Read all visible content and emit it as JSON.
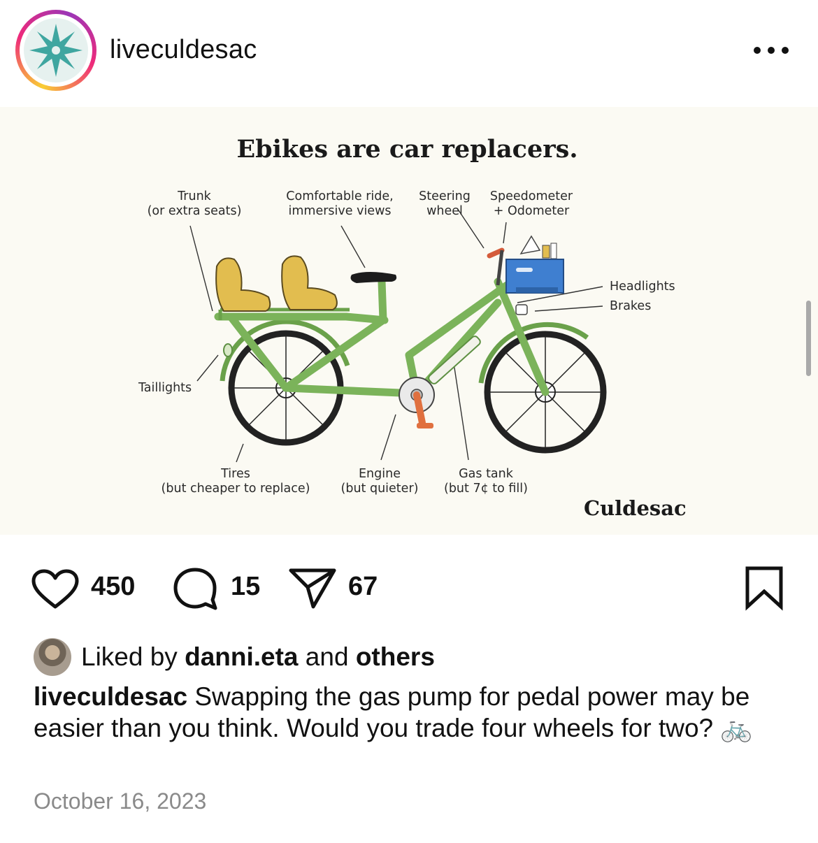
{
  "post": {
    "username": "liveculdesac",
    "more_icon": "more-horizontal-icon"
  },
  "infographic": {
    "title": "Ebikes are car replacers.",
    "labels": {
      "trunk": "Trunk",
      "trunk_sub": "(or extra seats)",
      "comfort": "Comfortable ride,",
      "comfort_sub": "immersive views",
      "steering": "Steering",
      "steering_sub": "wheel",
      "speedometer": "Speedometer",
      "speedometer_sub": "+ Odometer",
      "headlights": "Headlights",
      "brakes": "Brakes",
      "taillights": "Taillights",
      "tires": "Tires",
      "tires_sub": "(but cheaper to replace)",
      "engine": "Engine",
      "engine_sub": "(but quieter)",
      "gastank": "Gas tank",
      "gastank_sub": "(but 7¢ to fill)"
    },
    "brand": "Culdesac",
    "colors": {
      "frame": "#7bb35a",
      "seat": "#e2bd4f",
      "crate": "#3f7fd0",
      "pedal": "#e0703f",
      "background": "#fbfaf3"
    }
  },
  "actions": {
    "likes": "450",
    "comments": "15",
    "shares": "67"
  },
  "liked_by": {
    "prefix": "Liked by",
    "user": "danni.eta",
    "middle": "and",
    "others": "others"
  },
  "caption": {
    "username": "liveculdesac",
    "text": "Swapping the gas pump for pedal power may be easier than you think. Would you trade four wheels for two?",
    "emoji": "🚲"
  },
  "date": "October 16, 2023"
}
